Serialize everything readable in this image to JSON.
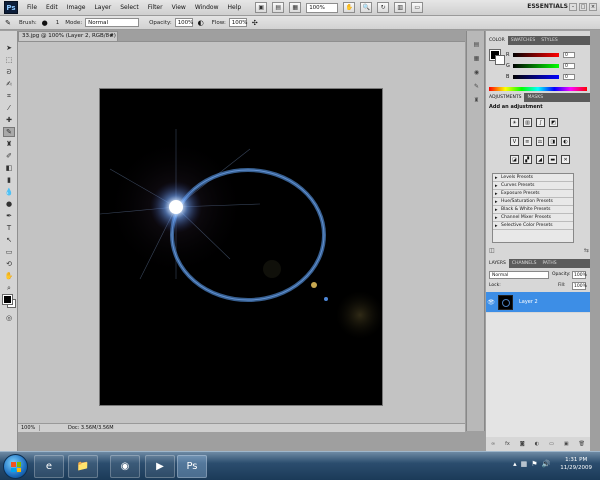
{
  "app": {
    "logo": "Ps",
    "workspace": "ESSENTIALS",
    "zoom": "100%"
  },
  "menu": [
    "File",
    "Edit",
    "Image",
    "Layer",
    "Select",
    "Filter",
    "View",
    "Window",
    "Help"
  ],
  "options": {
    "brush_label": "Brush:",
    "brush_size": "1",
    "mode_label": "Mode:",
    "mode_value": "Normal",
    "opacity_label": "Opacity:",
    "opacity_value": "100%",
    "flow_label": "Flow:",
    "flow_value": "100%"
  },
  "document": {
    "tab_title": "33.jpg @ 100% (Layer 2, RGB/8#)",
    "close": "×"
  },
  "status": {
    "zoom": "100%",
    "doc": "Doc: 3.56M/3.56M"
  },
  "panels": {
    "color_tabs": [
      "COLOR",
      "SWATCHES",
      "STYLES"
    ],
    "color": {
      "r_label": "R",
      "g_label": "G",
      "b_label": "B",
      "r": "0",
      "g": "0",
      "b": "0"
    },
    "adjust_tabs": [
      "ADJUSTMENTS",
      "MASKS"
    ],
    "adjust_title": "Add an adjustment",
    "presets": [
      "Levels Presets",
      "Curves Presets",
      "Exposure Presets",
      "Hue/Saturation Presets",
      "Black & White Presets",
      "Channel Mixer Presets",
      "Selective Color Presets"
    ],
    "layers_tabs": [
      "LAYERS",
      "CHANNELS",
      "PATHS"
    ],
    "blend_mode": "Normal",
    "opacity_label": "Opacity:",
    "opacity": "100%",
    "lock_label": "Lock:",
    "fill_label": "Fill:",
    "fill": "100%",
    "layer_name": "Layer 2"
  },
  "taskbar": {
    "time": "1:31 PM",
    "date": "11/29/2009",
    "apps": [
      "internet-explorer",
      "windows-explorer",
      "firefox",
      "media-player",
      "photoshop"
    ]
  },
  "colors": {
    "selection": "#3d8ee6",
    "flare": "#5c9ee0"
  }
}
